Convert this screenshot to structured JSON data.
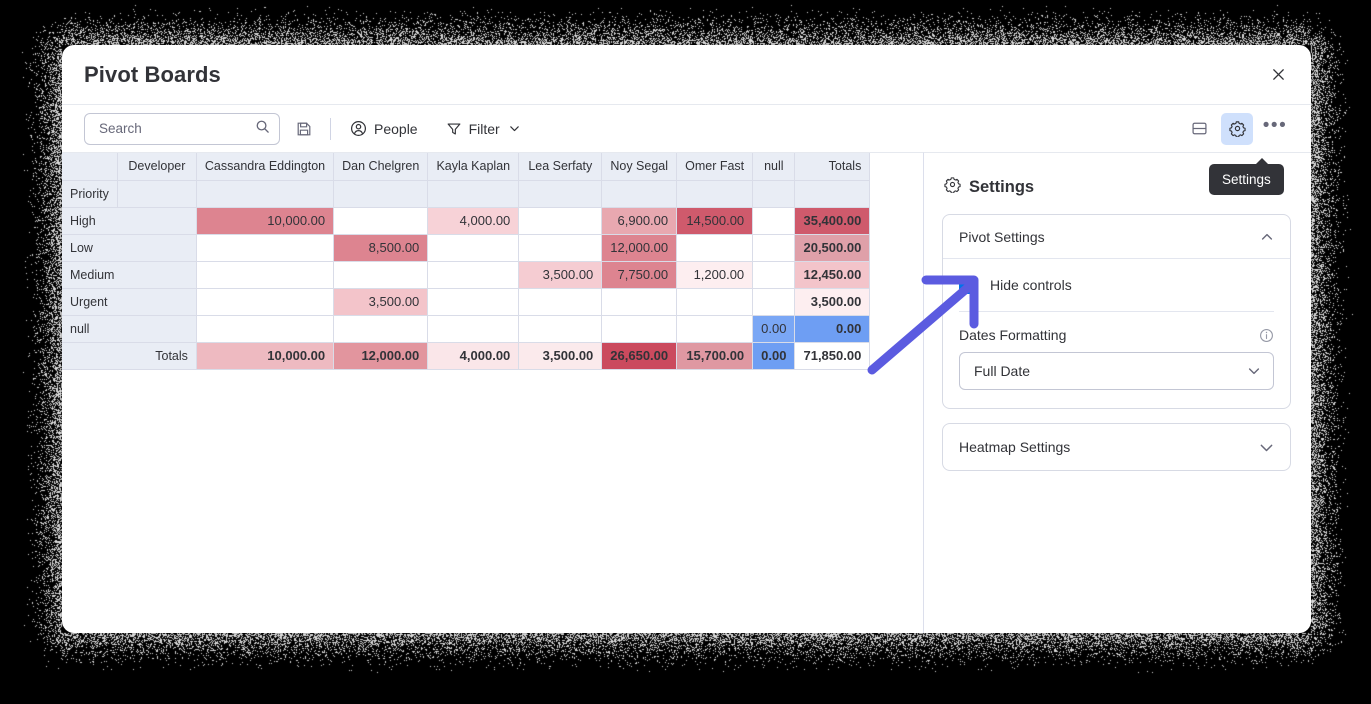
{
  "window": {
    "title": "Pivot Boards",
    "close_icon": "close-icon"
  },
  "toolbar": {
    "search": {
      "placeholder": "Search",
      "value": "",
      "icon": "search-icon"
    },
    "save_icon": "save-disk-icon",
    "people_button": {
      "label": "People",
      "icon": "person-circle-icon"
    },
    "filter_button": {
      "label": "Filter",
      "icon": "funnel-icon",
      "chevron": "chevron-down-icon"
    },
    "split_view_icon": "split-panel-icon",
    "settings_icon": "gear-icon",
    "more_icon": "ellipsis-icon"
  },
  "tooltip": {
    "text": "Settings"
  },
  "pivot": {
    "corner_label": "",
    "column_group_label": "Developer",
    "row_group_label": "Priority",
    "columns": [
      "Cassandra Eddington",
      "Dan Chelgren",
      "Kayla Kaplan",
      "Lea Serfaty",
      "Noy Segal",
      "Omer Fast",
      "null",
      "Totals"
    ],
    "rows": [
      {
        "label": "High",
        "cells": [
          {
            "text": "10,000.00",
            "bg": "#dd8490"
          },
          {
            "text": "",
            "bg": "#ffffff"
          },
          {
            "text": "4,000.00",
            "bg": "#f7d2d7"
          },
          {
            "text": "",
            "bg": "#ffffff"
          },
          {
            "text": "6,900.00",
            "bg": "#e8a8b0"
          },
          {
            "text": "14,500.00",
            "bg": "#cf5a6c"
          },
          {
            "text": "",
            "bg": "#ffffff"
          }
        ],
        "total": {
          "text": "35,400.00",
          "bg": "#cf5a6c"
        }
      },
      {
        "label": "Low",
        "cells": [
          {
            "text": "",
            "bg": "#ffffff"
          },
          {
            "text": "8,500.00",
            "bg": "#dd8490"
          },
          {
            "text": "",
            "bg": "#ffffff"
          },
          {
            "text": "",
            "bg": "#ffffff"
          },
          {
            "text": "12,000.00",
            "bg": "#dd8490"
          },
          {
            "text": "",
            "bg": "#ffffff"
          },
          {
            "text": "",
            "bg": "#ffffff"
          }
        ],
        "total": {
          "text": "20,500.00",
          "bg": "#dfa0a9"
        }
      },
      {
        "label": "Medium",
        "cells": [
          {
            "text": "",
            "bg": "#ffffff"
          },
          {
            "text": "",
            "bg": "#ffffff"
          },
          {
            "text": "",
            "bg": "#ffffff"
          },
          {
            "text": "3,500.00",
            "bg": "#f5ccd2"
          },
          {
            "text": "7,750.00",
            "bg": "#dd8490"
          },
          {
            "text": "1,200.00",
            "bg": "#fdeef0"
          },
          {
            "text": "",
            "bg": "#ffffff"
          }
        ],
        "total": {
          "text": "12,450.00",
          "bg": "#f3c4ca"
        }
      },
      {
        "label": "Urgent",
        "cells": [
          {
            "text": "",
            "bg": "#ffffff"
          },
          {
            "text": "3,500.00",
            "bg": "#f3c4ca"
          },
          {
            "text": "",
            "bg": "#ffffff"
          },
          {
            "text": "",
            "bg": "#ffffff"
          },
          {
            "text": "",
            "bg": "#ffffff"
          },
          {
            "text": "",
            "bg": "#ffffff"
          },
          {
            "text": "",
            "bg": "#ffffff"
          }
        ],
        "total": {
          "text": "3,500.00",
          "bg": "#fdeef0"
        }
      },
      {
        "label": "null",
        "cells": [
          {
            "text": "",
            "bg": "#ffffff"
          },
          {
            "text": "",
            "bg": "#ffffff"
          },
          {
            "text": "",
            "bg": "#ffffff"
          },
          {
            "text": "",
            "bg": "#ffffff"
          },
          {
            "text": "",
            "bg": "#ffffff"
          },
          {
            "text": "",
            "bg": "#ffffff"
          },
          {
            "text": "0.00",
            "bg": "#7aa7f5"
          }
        ],
        "total": {
          "text": "0.00",
          "bg": "#6e9ef3"
        }
      }
    ],
    "totals_row": {
      "label": "Totals",
      "cells": [
        {
          "text": "10,000.00",
          "bg": "#eebac1"
        },
        {
          "text": "12,000.00",
          "bg": "#e2959e"
        },
        {
          "text": "4,000.00",
          "bg": "#fae6e9"
        },
        {
          "text": "3,500.00",
          "bg": "#fbeaec"
        },
        {
          "text": "26,650.00",
          "bg": "#cb4a5e"
        },
        {
          "text": "15,700.00",
          "bg": "#df98a2"
        },
        {
          "text": "0.00",
          "bg": "#6e9ef3"
        }
      ],
      "total": {
        "text": "71,850.00",
        "bg": "#ffffff"
      }
    }
  },
  "settings": {
    "heading": "Settings",
    "heading_icon": "gear-icon",
    "pivot_card": {
      "title": "Pivot Settings",
      "collapse_icon": "chevron-up-icon",
      "hide_controls": {
        "label": "Hide controls",
        "checked": true
      },
      "dates_formatting": {
        "label": "Dates Formatting",
        "info_icon": "info-circle-icon",
        "selected": "Full Date",
        "chevron": "chevron-down-icon"
      }
    },
    "heatmap_card": {
      "title": "Heatmap Settings",
      "collapse_icon": "chevron-down-icon"
    }
  },
  "annotation": {
    "arrow_color": "#5B5BE0",
    "arrow_name": "pointer-arrow"
  }
}
